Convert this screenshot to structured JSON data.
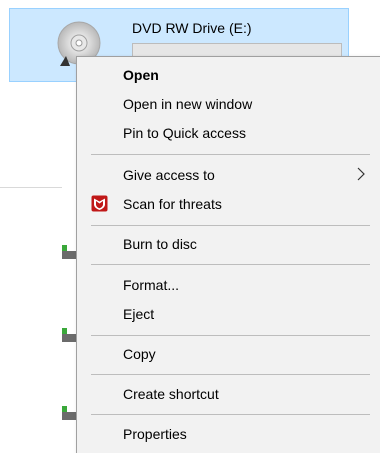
{
  "drive": {
    "label": "DVD RW Drive (E:)",
    "icon": "dvd-disc-icon",
    "selection_color": "#cce8ff"
  },
  "context_menu": {
    "items": [
      {
        "label": "Open",
        "bold": true
      },
      {
        "label": "Open in new window"
      },
      {
        "label": "Pin to Quick access"
      },
      {
        "label": "Give access to",
        "submenu": true
      },
      {
        "label": "Scan for threats",
        "icon": "mcafee-shield-icon",
        "icon_color": "#c01818"
      },
      {
        "label": "Burn to disc"
      },
      {
        "label": "Format..."
      },
      {
        "label": "Eject"
      },
      {
        "label": "Copy"
      },
      {
        "label": "Create shortcut"
      },
      {
        "label": "Properties"
      }
    ]
  }
}
